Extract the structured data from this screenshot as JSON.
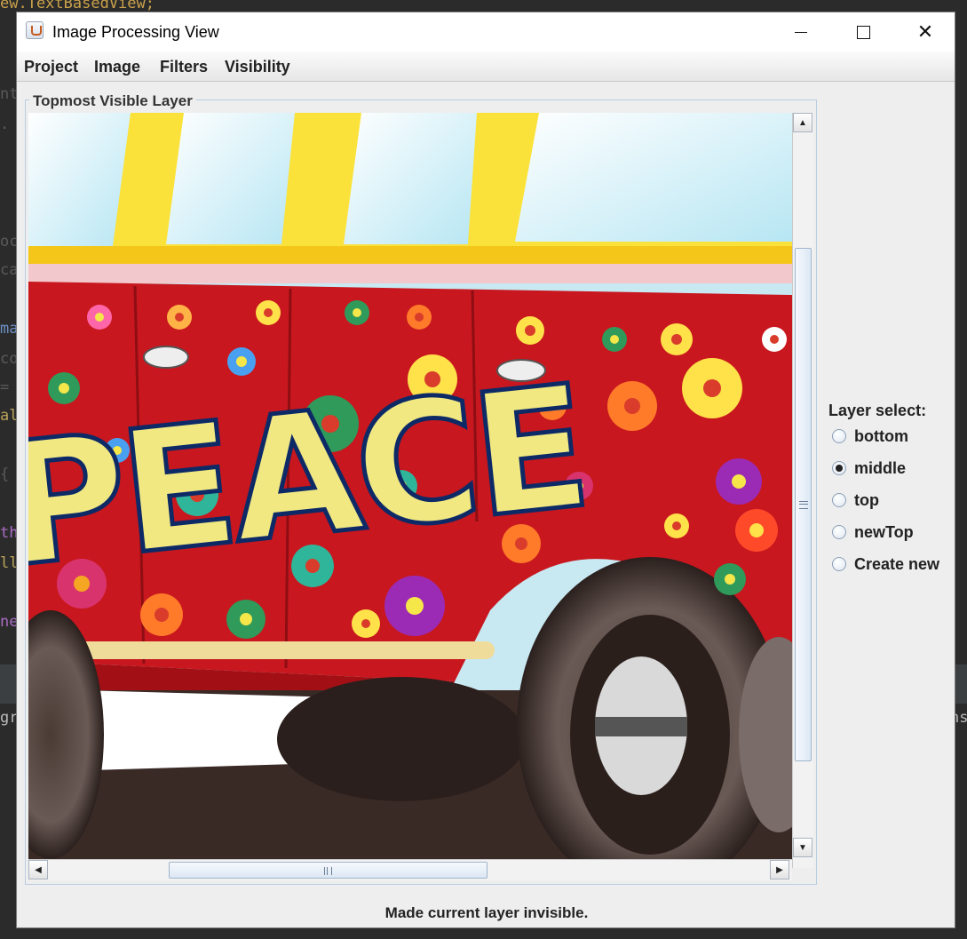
{
  "background_code": {
    "line_top": "ew.TextBasedView;",
    "frag_1": "nt",
    "frag_2": ".",
    "frag_3": "oc",
    "frag_4": "ca",
    "frag_5": "ma",
    "frag_6": "co",
    "frag_7": "=",
    "frag_8": "al",
    "frag_9": "{",
    "frag_10": "th",
    "frag_11": "ll",
    "frag_12": "ne",
    "frag_13": "gr",
    "frag_right": "ns"
  },
  "window": {
    "title": "Image Processing View",
    "icon": "java-cup-icon",
    "controls": {
      "minimize": "minimize-icon",
      "maximize": "maximize-icon",
      "close": "close-icon",
      "close_glyph": "✕"
    }
  },
  "menu": [
    "Project",
    "Image",
    "Filters",
    "Visibility"
  ],
  "panel": {
    "title": "Topmost Visible Layer",
    "image_text": "PEACE"
  },
  "scrollbars": {
    "up_arrow": "▲",
    "down_arrow": "▼",
    "left_arrow": "◀",
    "right_arrow": "▶",
    "vertical_position": 0.2,
    "horizontal_position": 0.18
  },
  "layer_select": {
    "title": "Layer select:",
    "options": [
      {
        "label": "bottom",
        "checked": false
      },
      {
        "label": "middle",
        "checked": true
      },
      {
        "label": "top",
        "checked": false
      },
      {
        "label": "newTop",
        "checked": false
      },
      {
        "label": "Create new",
        "checked": false
      }
    ]
  },
  "status": "Made current layer invisible.",
  "colors": {
    "accent_scroll": "#dce7f4",
    "window_bg": "#eeeeee",
    "bus_red": "#c8171e",
    "bus_yellow": "#f3dc1c"
  }
}
